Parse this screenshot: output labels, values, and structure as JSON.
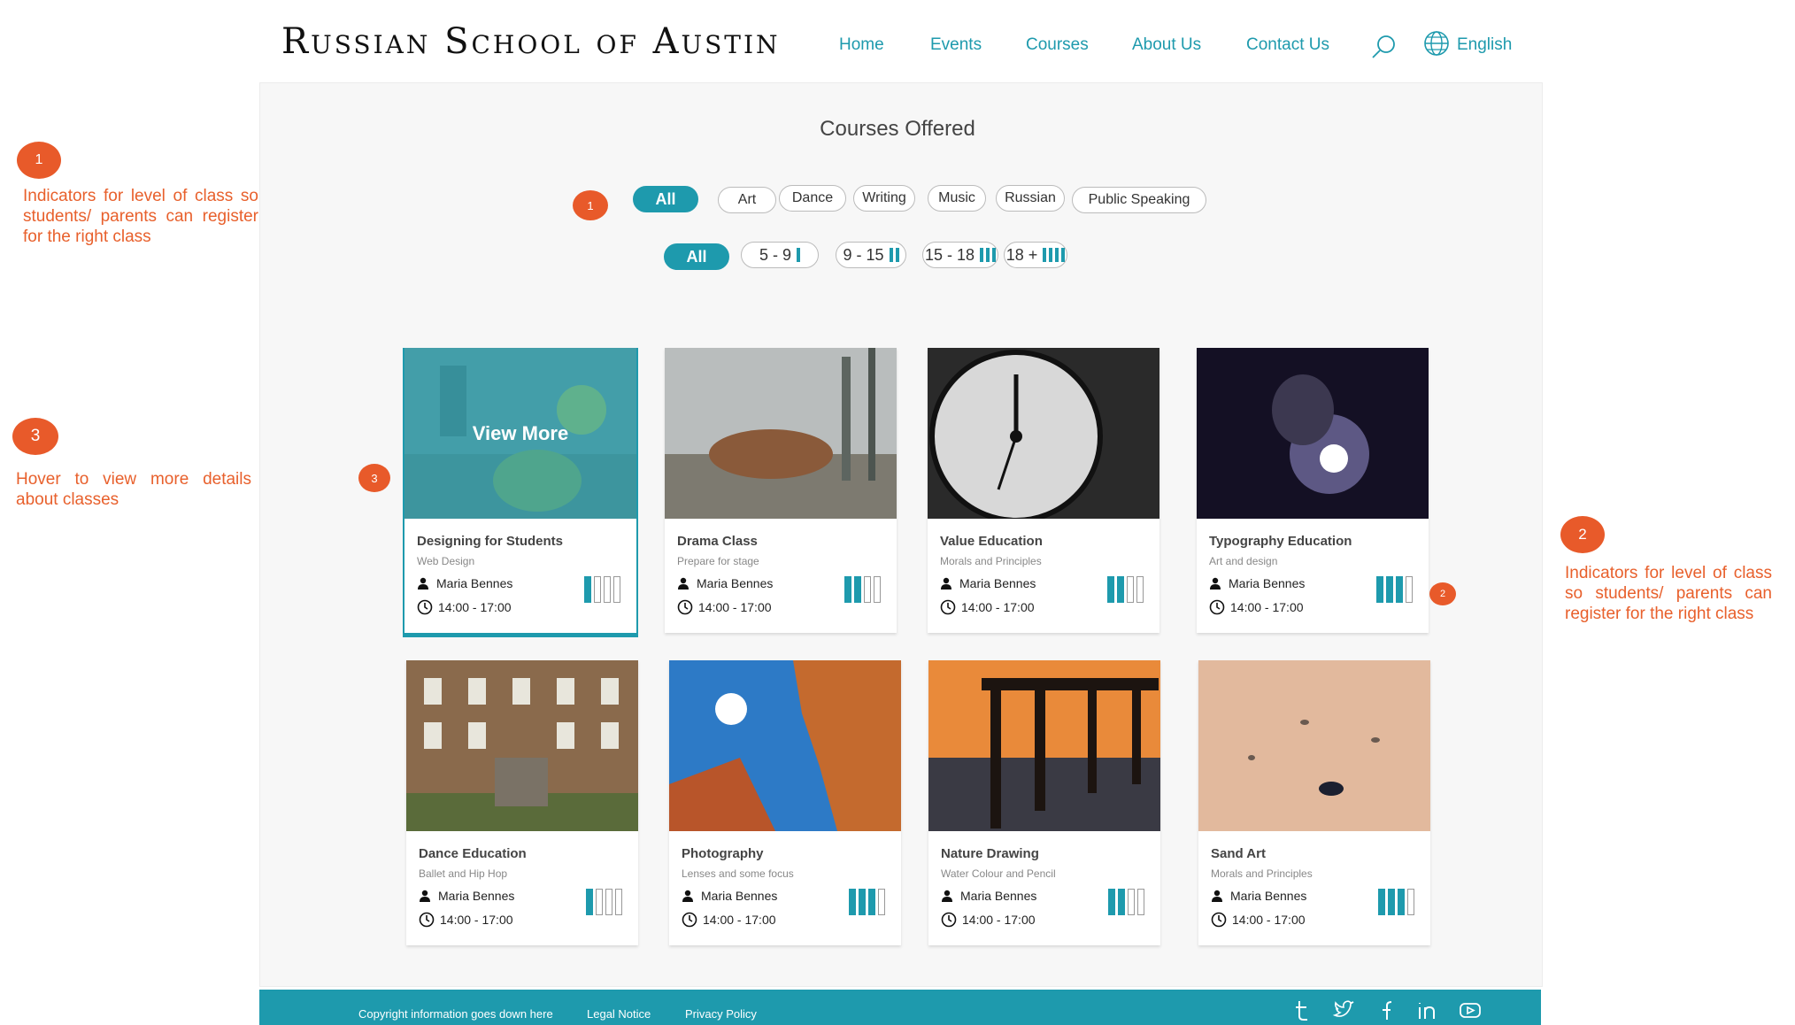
{
  "header": {
    "logo": "Russian School of Austin",
    "nav": [
      "Home",
      "Events",
      "Courses",
      "About Us",
      "Contact Us"
    ],
    "active_nav": "Courses",
    "language": "English"
  },
  "main": {
    "title": "Courses Offered",
    "category_filters": [
      "All",
      "Art",
      "Dance",
      "Writing",
      "Music",
      "Russian",
      "Public Speaking"
    ],
    "age_filters": [
      {
        "label": "All",
        "level": 0
      },
      {
        "label": "5 - 9",
        "level": 1
      },
      {
        "label": "9 - 15",
        "level": 2
      },
      {
        "label": "15 - 18",
        "level": 3
      },
      {
        "label": "18 +",
        "level": 4
      }
    ],
    "hover_label": "View More",
    "courses": [
      {
        "title": "Designing for Students",
        "subtitle": "Web Design",
        "teacher": "Maria Bennes",
        "time": "14:00 - 17:00",
        "level": 1
      },
      {
        "title": "Drama Class",
        "subtitle": "Prepare for stage",
        "teacher": "Maria Bennes",
        "time": "14:00 - 17:00",
        "level": 2
      },
      {
        "title": "Value Education",
        "subtitle": "Morals and Principles",
        "teacher": "Maria Bennes",
        "time": "14:00 - 17:00",
        "level": 2
      },
      {
        "title": "Typography Education",
        "subtitle": "Art and design",
        "teacher": "Maria Bennes",
        "time": "14:00 - 17:00",
        "level": 3
      },
      {
        "title": "Dance Education",
        "subtitle": "Ballet and Hip Hop",
        "teacher": "Maria Bennes",
        "time": "14:00 - 17:00",
        "level": 1
      },
      {
        "title": "Photography",
        "subtitle": "Lenses and some focus",
        "teacher": "Maria Bennes",
        "time": "14:00 - 17:00",
        "level": 3
      },
      {
        "title": "Nature Drawing",
        "subtitle": "Water Colour and Pencil",
        "teacher": "Maria Bennes",
        "time": "14:00 - 17:00",
        "level": 2
      },
      {
        "title": "Sand Art",
        "subtitle": "Morals and Principles",
        "teacher": "Maria Bennes",
        "time": "14:00 - 17:00",
        "level": 3
      }
    ]
  },
  "annotations": {
    "badge1": "1",
    "badge2": "2",
    "badge3": "3",
    "note1": "Indicators for level of class so students/ parents can register for the right class",
    "note2": "Indicators for level of class so students/ parents can register for the right class",
    "note3": "Hover to view more details about classes"
  },
  "footer": {
    "copyright": "Copyright information goes down here",
    "legal": "Legal Notice",
    "privacy": "Privacy Policy",
    "social_icons": [
      "tumblr-icon",
      "twitter-icon",
      "facebook-icon",
      "linkedin-icon",
      "youtube-icon"
    ]
  },
  "colors": {
    "accent": "#1e9aad",
    "annotation": "#e85a2a"
  }
}
